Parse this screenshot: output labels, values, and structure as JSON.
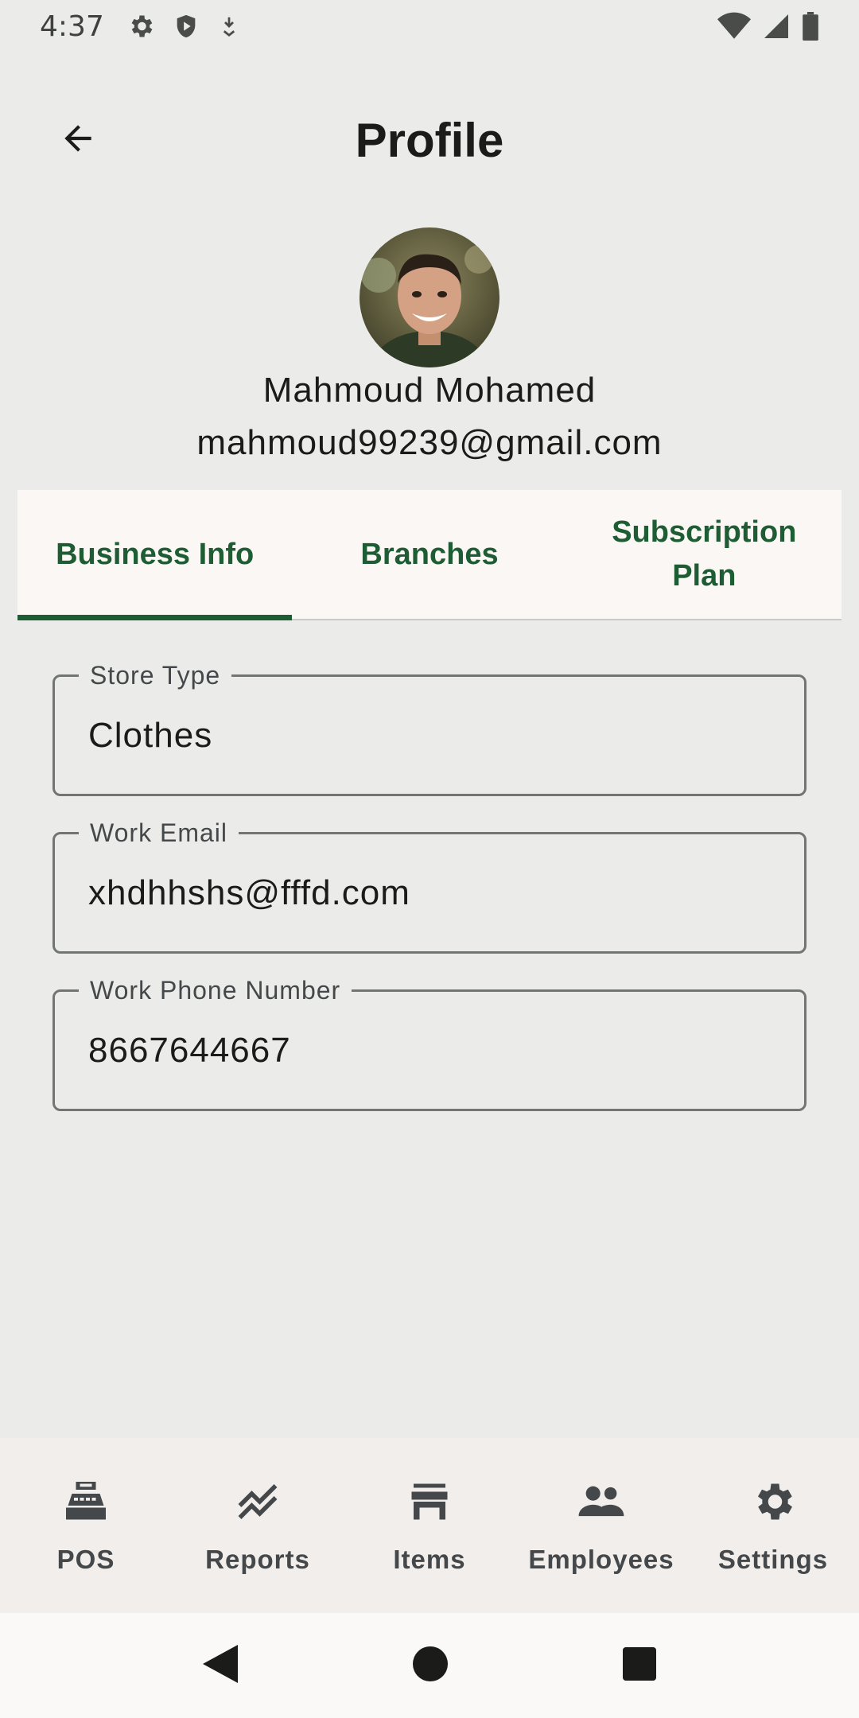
{
  "status_bar": {
    "time": "4:37",
    "left_icons": [
      "gear-icon",
      "shield-icon",
      "download-icon"
    ],
    "right_icons": [
      "wifi-icon",
      "signal-icon",
      "battery-icon"
    ]
  },
  "header": {
    "title": "Profile",
    "back_icon": "arrow-back-icon"
  },
  "profile": {
    "name": "Mahmoud Mohamed",
    "email": "mahmoud99239@gmail.com"
  },
  "tabs": [
    {
      "label": "Business Info",
      "active": true
    },
    {
      "label": "Branches",
      "active": false
    },
    {
      "label": "Subscription Plan",
      "active": false
    }
  ],
  "fields": [
    {
      "label": "Store Type",
      "value": "Clothes"
    },
    {
      "label": "Work Email",
      "value": "xhdhhshs@fffd.com"
    },
    {
      "label": "Work Phone Number",
      "value": "8667644667"
    }
  ],
  "bottom_nav": [
    {
      "label": "POS",
      "icon": "cash-register-icon"
    },
    {
      "label": "Reports",
      "icon": "chart-line-icon"
    },
    {
      "label": "Items",
      "icon": "store-icon"
    },
    {
      "label": "Employees",
      "icon": "people-icon"
    },
    {
      "label": "Settings",
      "icon": "gear-icon"
    }
  ],
  "colors": {
    "accent": "#1e5c34",
    "background": "#ebece9",
    "tab_background": "#faf7f4",
    "nav_background": "#f1eeec"
  }
}
